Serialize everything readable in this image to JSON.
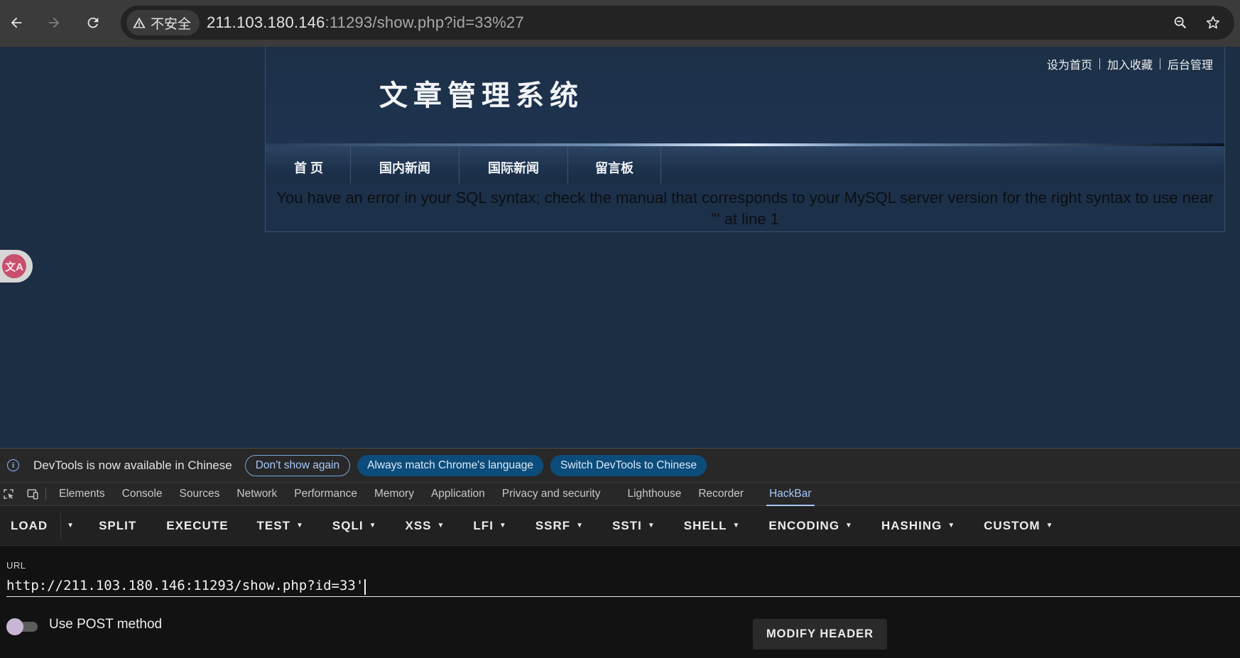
{
  "browser": {
    "security_label": "不安全",
    "url_host": "211.103.180.146",
    "url_rest": ":11293/show.php?id=33%27"
  },
  "site": {
    "logo": "文章管理系统",
    "top_links": [
      "设为首页",
      "加入收藏",
      "后台管理"
    ],
    "menu": [
      "首 页",
      "国内新闻",
      "国际新闻",
      "留言板"
    ],
    "error_message": "You have an error in your SQL syntax; check the manual that corresponds to your MySQL server version for the right syntax to use near ''' at line 1"
  },
  "translate_widget": {
    "icon": "translate-icon",
    "glyph": "文A"
  },
  "devtools": {
    "infobar": {
      "message": "DevTools is now available in Chinese",
      "dont_show": "Don't show again",
      "always_match": "Always match Chrome's language",
      "switch": "Switch DevTools to Chinese"
    },
    "tabs": [
      "Elements",
      "Console",
      "Sources",
      "Network",
      "Performance",
      "Memory",
      "Application",
      "Privacy and security",
      "Lighthouse",
      "Recorder",
      "HackBar"
    ],
    "active_tab": "HackBar",
    "hackbar": {
      "toolbar": {
        "load": "LOAD",
        "split": "SPLIT",
        "execute": "EXECUTE",
        "menus": [
          "TEST",
          "SQLI",
          "XSS",
          "LFI",
          "SSRF",
          "SSTI",
          "SHELL",
          "ENCODING",
          "HASHING",
          "CUSTOM"
        ]
      },
      "url_label": "URL",
      "url_value": "http://211.103.180.146:11293/show.php?id=33'",
      "use_post_label": "Use POST method",
      "use_post_enabled": false,
      "modify_header": "MODIFY HEADER"
    }
  },
  "colors": {
    "page_bg": "#1c2e44",
    "accent": "#a8c7fa",
    "pill_filled": "#0c4c7a"
  }
}
